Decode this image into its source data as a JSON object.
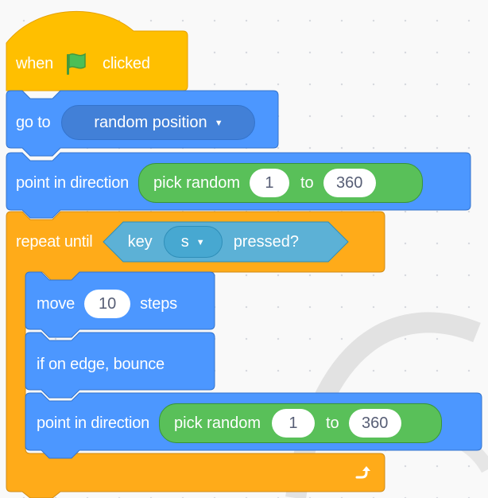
{
  "hat": {
    "when_label": "when",
    "clicked_label": "clicked",
    "flag_icon": "green-flag-icon"
  },
  "goto": {
    "label": "go to",
    "menu_value": "random position"
  },
  "point1": {
    "label": "point in direction",
    "random_label": "pick random",
    "from_value": "1",
    "to_label": "to",
    "to_value": "360"
  },
  "repeat": {
    "label": "repeat until",
    "key_label": "key",
    "key_value": "s",
    "pressed_label": "pressed?",
    "loop_icon": "loop-arrow-icon"
  },
  "move": {
    "label": "move",
    "value": "10",
    "steps_label": "steps"
  },
  "bounce": {
    "label": "if on edge, bounce"
  },
  "point2": {
    "label": "point in direction",
    "random_label": "pick random",
    "from_value": "1",
    "to_label": "to",
    "to_value": "360"
  },
  "colors": {
    "events": "#ffbf00",
    "motion": "#4c97ff",
    "motion_dark": "#4280d7",
    "control": "#ffab19",
    "operators": "#59c059",
    "sensing": "#5cb1d6"
  }
}
